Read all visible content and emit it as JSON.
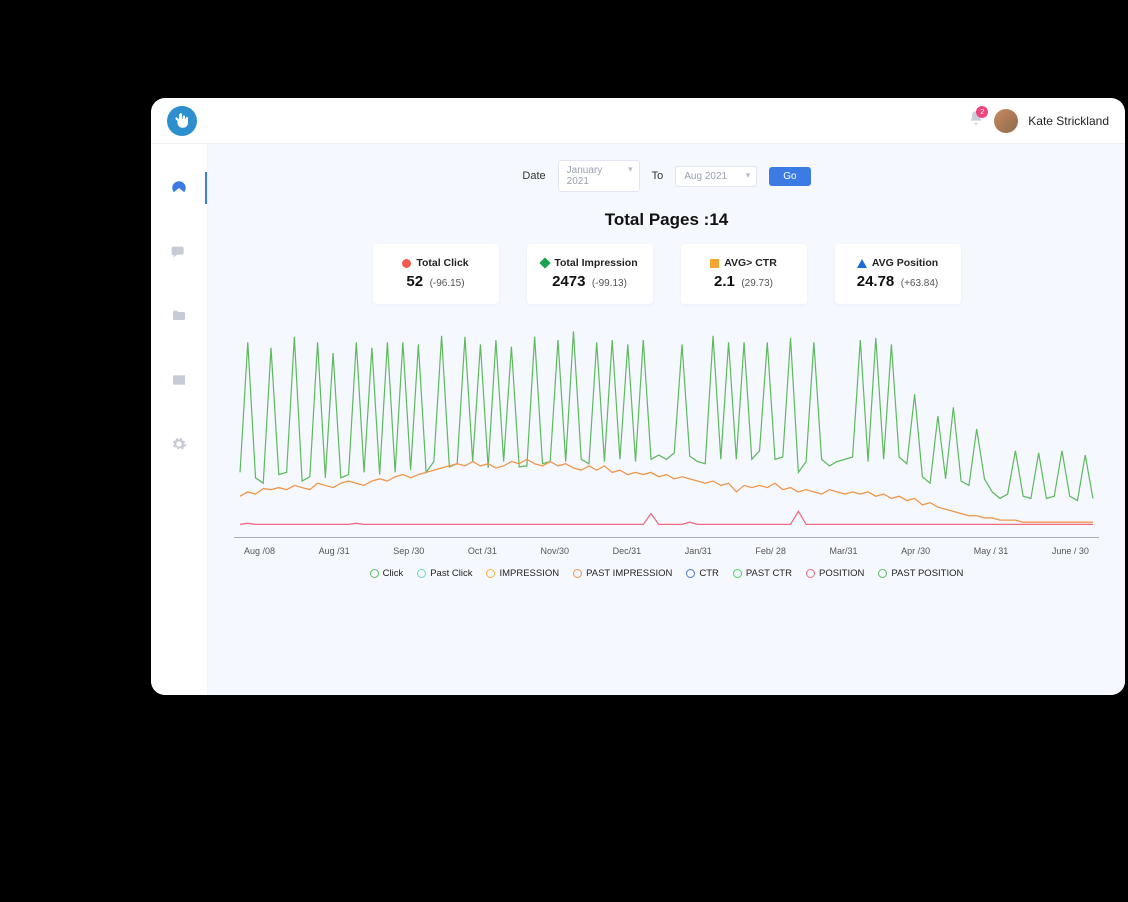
{
  "header": {
    "notification_count": "2",
    "user_name": "Kate Strickland"
  },
  "filters": {
    "date_label": "Date",
    "from_value": "January 2021",
    "to_label": "To",
    "to_value": "Aug  2021",
    "go_label": "Go"
  },
  "summary": {
    "total_pages_label": "Total Pages :",
    "total_pages_value": "14"
  },
  "kpis": [
    {
      "label": "Total Click",
      "value": "52",
      "delta": "(-96.15)",
      "shape": "circle",
      "color": "#f15b4f"
    },
    {
      "label": "Total Impression",
      "value": "2473",
      "delta": "(-99.13)",
      "shape": "diamond",
      "color": "#1aa34a"
    },
    {
      "label": "AVG> CTR",
      "value": "2.1",
      "delta": "(29.73)",
      "shape": "square",
      "color": "#f5a52e"
    },
    {
      "label": "AVG Position",
      "value": "24.78",
      "delta": "(+63.84)",
      "shape": "triangle",
      "color": "#1d6bd6"
    }
  ],
  "legend": [
    {
      "label": "Click",
      "color": "#5fb95f"
    },
    {
      "label": "Past Click",
      "color": "#63d4c9"
    },
    {
      "label": "IMPRESSION",
      "color": "#f5b43a"
    },
    {
      "label": "PAST IMPRESSION",
      "color": "#f0964b"
    },
    {
      "label": "CTR",
      "color": "#4a77d4"
    },
    {
      "label": "PAST CTR",
      "color": "#4bd15f"
    },
    {
      "label": "POSITION",
      "color": "#ef6b7d"
    },
    {
      "label": "PAST POSITION",
      "color": "#5fb95f"
    }
  ],
  "chart_data": {
    "type": "line",
    "xlabel": "",
    "ylabel": "",
    "ylim": [
      0,
      200
    ],
    "categories": [
      "Aug /08",
      "Aug /31",
      "Sep /30",
      "Oct /31",
      "Nov/30",
      "Dec/31",
      "Jan/31",
      "Feb/ 28",
      "Mar/31",
      "Apr /30",
      "May / 31",
      "June / 30"
    ],
    "series": [
      {
        "name": "Click",
        "color": "#5fb95f",
        "values": [
          60,
          180,
          55,
          50,
          175,
          58,
          60,
          185,
          52,
          56,
          180,
          55,
          170,
          55,
          58,
          180,
          60,
          175,
          58,
          180,
          60,
          180,
          62,
          178,
          60,
          70,
          186,
          65,
          68,
          185,
          70,
          178,
          64,
          182,
          70,
          176,
          65,
          66,
          185,
          68,
          70,
          182,
          70,
          190,
          72,
          68,
          180,
          70,
          182,
          72,
          178,
          70,
          182,
          72,
          76,
          72,
          78,
          178,
          75,
          70,
          68,
          186,
          72,
          180,
          72,
          180,
          72,
          80,
          180,
          72,
          74,
          184,
          60,
          70,
          180,
          72,
          66,
          70,
          72,
          74,
          182,
          70,
          184,
          72,
          178,
          74,
          68,
          132,
          56,
          50,
          112,
          54,
          120,
          52,
          48,
          100,
          54,
          42,
          36,
          40,
          80,
          38,
          36,
          78,
          36,
          38,
          80,
          38,
          34,
          76,
          36
        ]
      },
      {
        "name": "PAST IMPRESSION",
        "color": "#f0964b",
        "values": [
          38,
          42,
          40,
          45,
          44,
          46,
          44,
          48,
          46,
          44,
          50,
          48,
          46,
          50,
          52,
          50,
          48,
          52,
          54,
          52,
          56,
          58,
          55,
          58,
          60,
          62,
          64,
          66,
          68,
          66,
          70,
          66,
          68,
          64,
          66,
          70,
          68,
          72,
          68,
          66,
          70,
          66,
          68,
          64,
          62,
          66,
          62,
          66,
          60,
          62,
          58,
          60,
          58,
          60,
          56,
          58,
          54,
          56,
          54,
          52,
          50,
          52,
          48,
          50,
          42,
          48,
          46,
          48,
          46,
          50,
          44,
          46,
          42,
          44,
          42,
          40,
          44,
          42,
          40,
          42,
          40,
          42,
          38,
          40,
          36,
          38,
          34,
          36,
          30,
          32,
          28,
          26,
          24,
          22,
          20,
          20,
          18,
          18,
          16,
          16,
          16,
          14,
          14,
          14,
          14,
          14,
          14,
          14,
          14,
          14,
          14
        ]
      },
      {
        "name": "POSITION",
        "color": "#ef6b7d",
        "values": [
          12,
          13,
          12,
          12,
          12,
          12,
          12,
          12,
          12,
          12,
          12,
          12,
          12,
          12,
          12,
          13,
          12,
          12,
          12,
          12,
          12,
          12,
          12,
          12,
          12,
          12,
          12,
          12,
          12,
          12,
          12,
          12,
          12,
          12,
          12,
          12,
          12,
          12,
          12,
          12,
          12,
          12,
          12,
          12,
          12,
          12,
          12,
          12,
          12,
          12,
          12,
          12,
          12,
          22,
          12,
          12,
          12,
          12,
          14,
          12,
          12,
          12,
          12,
          12,
          12,
          12,
          12,
          12,
          12,
          12,
          12,
          12,
          24,
          12,
          12,
          12,
          12,
          12,
          12,
          12,
          12,
          12,
          12,
          12,
          12,
          12,
          12,
          12,
          12,
          12,
          12,
          12,
          12,
          12,
          12,
          12,
          12,
          12,
          12,
          12,
          12,
          12,
          12,
          12,
          12,
          12,
          12,
          12,
          12,
          12,
          12
        ]
      }
    ]
  }
}
